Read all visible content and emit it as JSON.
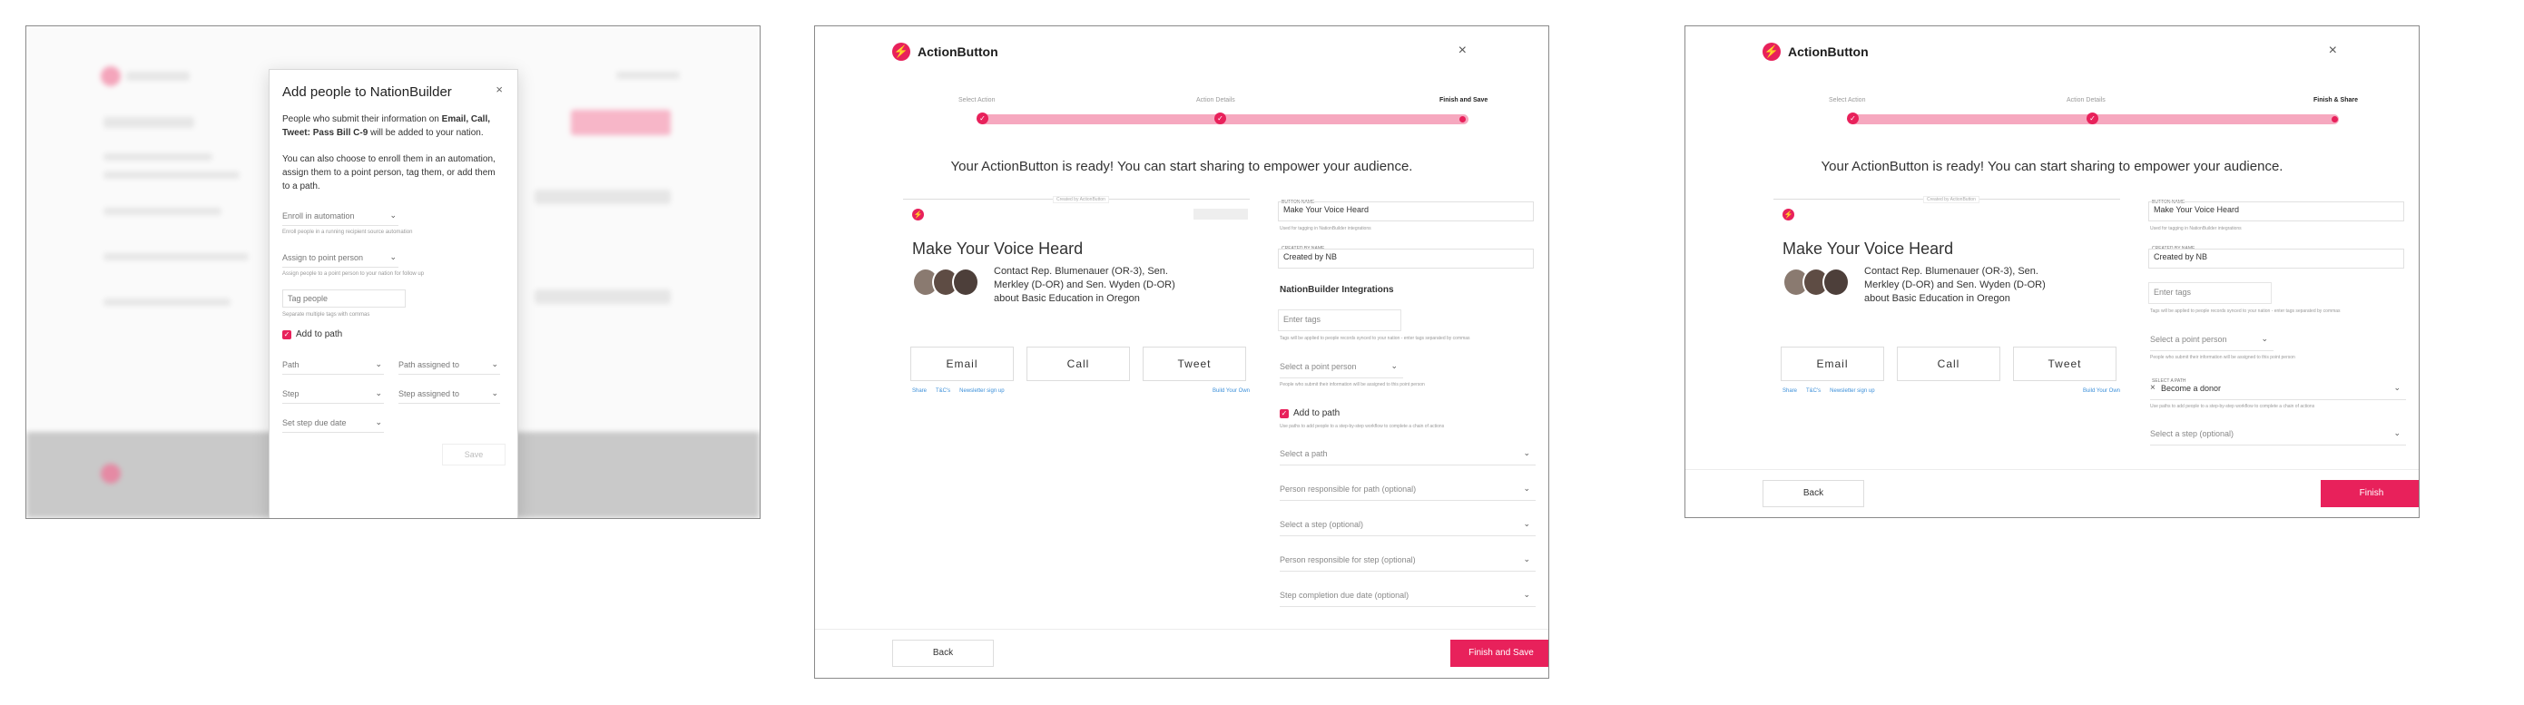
{
  "panel1": {
    "modal": {
      "title": "Add people to NationBuilder",
      "close": "×",
      "intro_pre": "People who submit their information on ",
      "intro_bold": "Email, Call, Tweet: Pass Bill C-9",
      "intro_post": " will be added to your nation.",
      "intro2": "You can also choose to enroll them in an automation, assign them to a point person, tag them, or add them to a path.",
      "automation_placeholder": "Enroll in automation",
      "automation_hint": "Enroll people in a running recipient source automation",
      "point_person_placeholder": "Assign to point person",
      "point_person_hint": "Assign people to a point person to your nation for follow up",
      "tag_placeholder": "Tag people",
      "tag_hint": "Separate multiple tags with commas",
      "add_to_path": "Add to path",
      "path": "Path",
      "path_assigned_to": "Path assigned to",
      "step": "Step",
      "step_assigned_to": "Step assigned to",
      "due_date": "Set step due date",
      "save": "Save"
    }
  },
  "wizard": {
    "brand": "ActionButton",
    "close": "×",
    "steps": [
      "Select Action",
      "Action Details"
    ],
    "ready_message": "Your ActionButton is ready! You can start sharing to empower your audience.",
    "preview": {
      "tag": "Created by ActionButton",
      "title": "Make Your Voice Heard",
      "description": "Contact Rep. Blumenauer (OR-3), Sen. Merkley (D-OR) and Sen. Wyden (D-OR) about Basic Education in Oregon",
      "buttons": [
        "Email",
        "Call",
        "Tweet"
      ],
      "links": [
        "Share",
        "T&C's",
        "Newsletter sign up"
      ],
      "build_link": "Build Your Own"
    },
    "button_name_label": "Button name",
    "button_name_value": "Make Your Voice Heard",
    "button_name_hint": "Used for tagging in NationBuilder integrations",
    "created_by_label": "Created by name",
    "created_by_value": "Created by NB",
    "tags_placeholder": "Enter tags",
    "tags_hint": "Tags will be applied to people records synced to your nation - enter tags separated by commas",
    "point_person_placeholder": "Select a point person",
    "point_person_hint": "People who submit their information will be assigned to this point person",
    "add_to_path": "Add to path",
    "path_hint": "Use paths to add people to a step-by-step workflow to complete a chain of actions",
    "back": "Back"
  },
  "panel2": {
    "final_step": "Finish and Save",
    "integrations_heading": "NationBuilder Integrations",
    "path_placeholder": "Select a path",
    "path_person": "Person responsible for path (optional)",
    "step_placeholder": "Select a step (optional)",
    "step_person": "Person responsible for step (optional)",
    "due_date": "Step completion due date (optional)",
    "finish": "Finish and Save"
  },
  "panel3": {
    "final_step": "Finish & Share",
    "path_label": "Select a path",
    "path_value": "Become a donor",
    "path_clear": "×",
    "step_placeholder": "Select a step (optional)",
    "finish": "Finish"
  },
  "colors": {
    "accent": "#e8215b",
    "accent_light": "#f6a8bf"
  }
}
